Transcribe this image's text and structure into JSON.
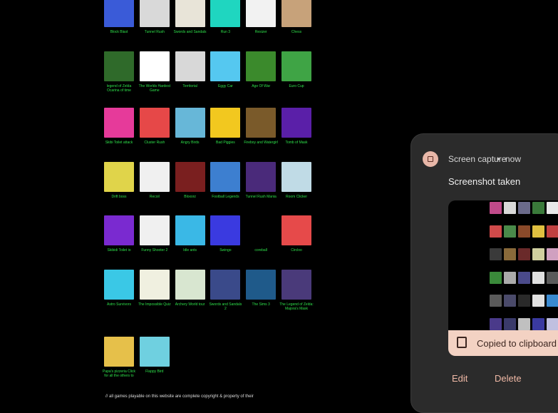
{
  "games": [
    {
      "name": "Block Blast",
      "color": "#3a5bd8"
    },
    {
      "name": "Tunnel Rush",
      "color": "#d9d9d9"
    },
    {
      "name": "Swords and Sandals",
      "color": "#e8e4d8"
    },
    {
      "name": "Run 3",
      "color": "#1fd6c0"
    },
    {
      "name": "Resizer",
      "color": "#f2f2f2"
    },
    {
      "name": "Chess",
      "color": "#c7a27a"
    },
    {
      "name": "legend of Zelda Ocarina of time",
      "color": "#2f6a2a"
    },
    {
      "name": "The Worlds Hardest Game",
      "color": "#ffffff"
    },
    {
      "name": "Territorial",
      "color": "#d8d8d8"
    },
    {
      "name": "Eggy Car",
      "color": "#55c8f0"
    },
    {
      "name": "Age Of War",
      "color": "#3b8a2c"
    },
    {
      "name": "Euro Cup",
      "color": "#3fa445"
    },
    {
      "name": "Skibi Toilet attack",
      "color": "#e63a9a"
    },
    {
      "name": "Cluster Rush",
      "color": "#e64848"
    },
    {
      "name": "Angry Birds",
      "color": "#67b7d8"
    },
    {
      "name": "Bad Piggies",
      "color": "#f2c81f"
    },
    {
      "name": "Fireboy and Watergirl",
      "color": "#7a5a2a"
    },
    {
      "name": "Tomb of Mask",
      "color": "#5a1fa8"
    },
    {
      "name": "Drift boss",
      "color": "#e0d44a"
    },
    {
      "name": "Recoil",
      "color": "#f0f0f0"
    },
    {
      "name": "Bloxorz",
      "color": "#7a1f1f"
    },
    {
      "name": "Football Legends",
      "color": "#3d7fd0"
    },
    {
      "name": "Tunnel Rush Mania",
      "color": "#4a2a7a"
    },
    {
      "name": "Room Clicker",
      "color": "#c0dbe6"
    },
    {
      "name": "Skibidi Toilet io",
      "color": "#7a2ad0"
    },
    {
      "name": "Funny Shooter 2",
      "color": "#f0f0f0"
    },
    {
      "name": "Idle ants",
      "color": "#3ab8e6"
    },
    {
      "name": "Swingo",
      "color": "#3a3ae0"
    },
    {
      "name": "coreball",
      "color": "#000000"
    },
    {
      "name": "Circloo",
      "color": "#e64a4a"
    },
    {
      "name": "Astro Survivors",
      "color": "#3ac8e6"
    },
    {
      "name": "The Impossible Quiz",
      "color": "#f0f0e0"
    },
    {
      "name": "Archery World tour",
      "color": "#d8e6d0"
    },
    {
      "name": "Swords and Sandals 2",
      "color": "#3a4a8a"
    },
    {
      "name": "The Sims 3",
      "color": "#1f5a8a"
    },
    {
      "name": "The Legend of Zelda: Majora's Mask",
      "color": "#4a3a7a"
    },
    {
      "name": "Papa's pizzeria Click for all the others to",
      "color": "#e6c04a"
    },
    {
      "name": "Flappy Bird",
      "color": "#6fd0e0"
    }
  ],
  "footer_text": "// all games playable on this website are complete copyright & property of their",
  "notification": {
    "app_name": "Screen capture",
    "separator": "•",
    "time": "now",
    "title": "Screenshot taken",
    "copied_label": "Copied to clipboard",
    "edit_label": "Edit",
    "delete_label": "Delete"
  },
  "colors": {
    "panel_bg": "#2b2b2b",
    "accent": "#f0b9a6",
    "chip_bg": "#f3d2c3",
    "caption_green": "#2ee04a"
  }
}
